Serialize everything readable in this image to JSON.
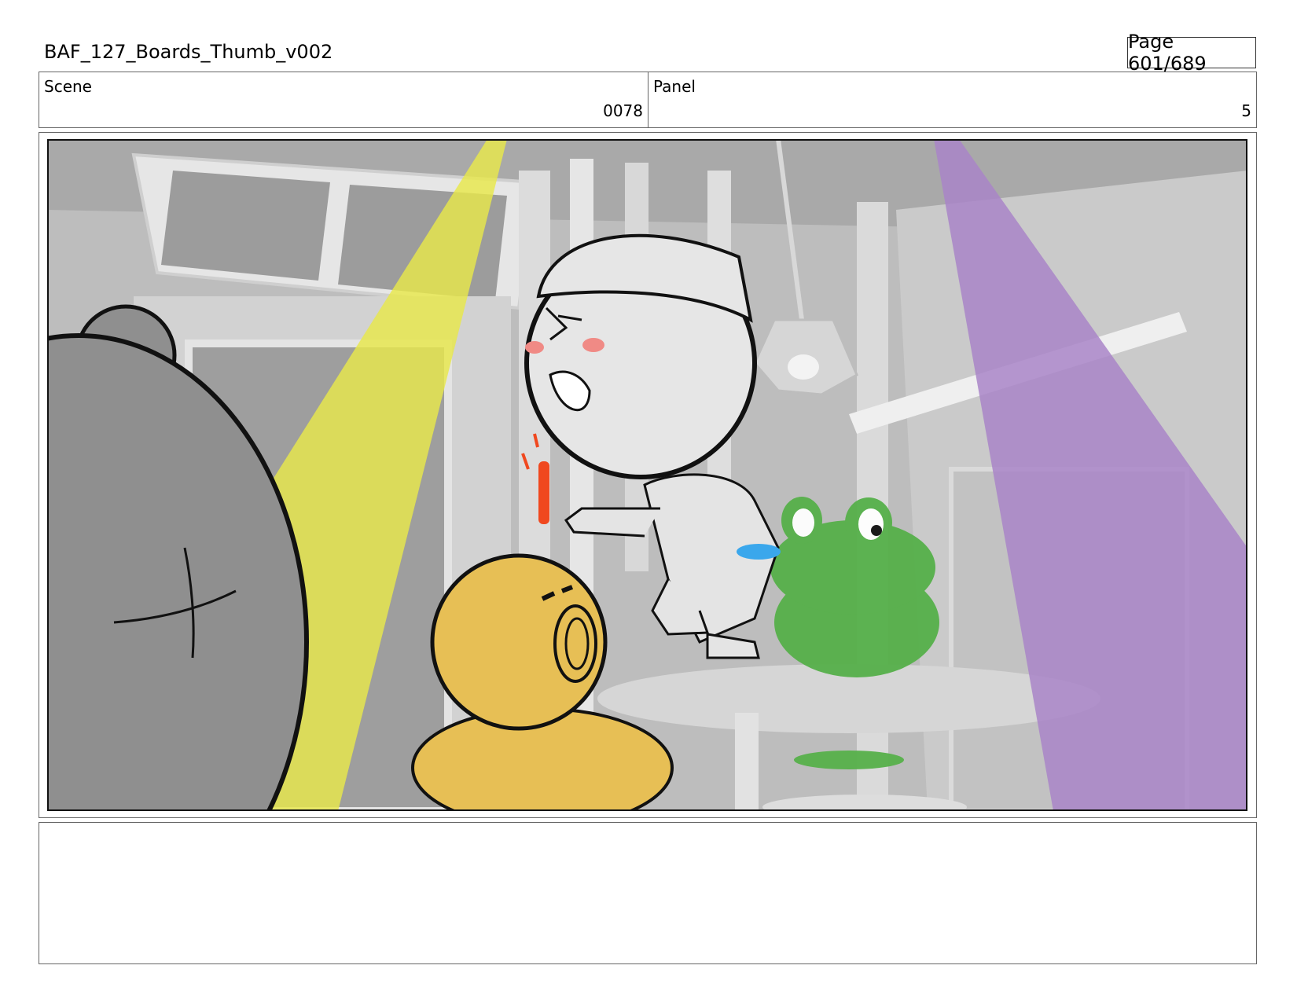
{
  "header": {
    "document_title": "BAF_127_Boards_Thumb_v002",
    "page_label": "Page 601/689"
  },
  "info": {
    "scene_label": "Scene",
    "scene_value": "0078",
    "panel_label": "Panel",
    "panel_value": "5"
  },
  "frame": {
    "subject": "storyboard-panel-artwork",
    "colors": {
      "background": "#bdbdbd",
      "yellow_light": "#e8e84a",
      "purple_light": "#a985c8",
      "bear": "#8f8f8f",
      "chick": "#e7bf55",
      "frog": "#56b04a",
      "character": "#e4e4e4"
    }
  },
  "notes": {
    "text": ""
  }
}
